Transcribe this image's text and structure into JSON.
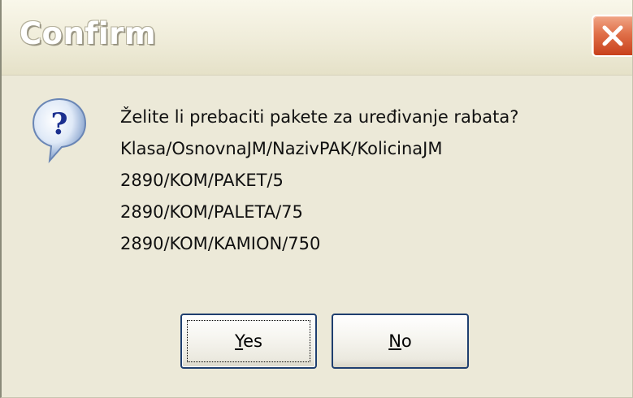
{
  "window": {
    "title": "Confirm",
    "close_icon": "close-x-icon",
    "accent_close": "#e07049"
  },
  "icon": {
    "name": "question-icon",
    "glyph": "?"
  },
  "message": {
    "lines": [
      "Želite li prebaciti pakete za uređivanje rabata?",
      "Klasa/OsnovnaJM/NazivPAK/KolicinaJM",
      "2890/KOM/PAKET/5",
      "2890/KOM/PALETA/75",
      "2890/KOM/KAMION/750"
    ]
  },
  "buttons": {
    "yes": {
      "mnemonic": "Y",
      "rest": "es"
    },
    "no": {
      "mnemonic": "N",
      "rest": "o"
    }
  }
}
